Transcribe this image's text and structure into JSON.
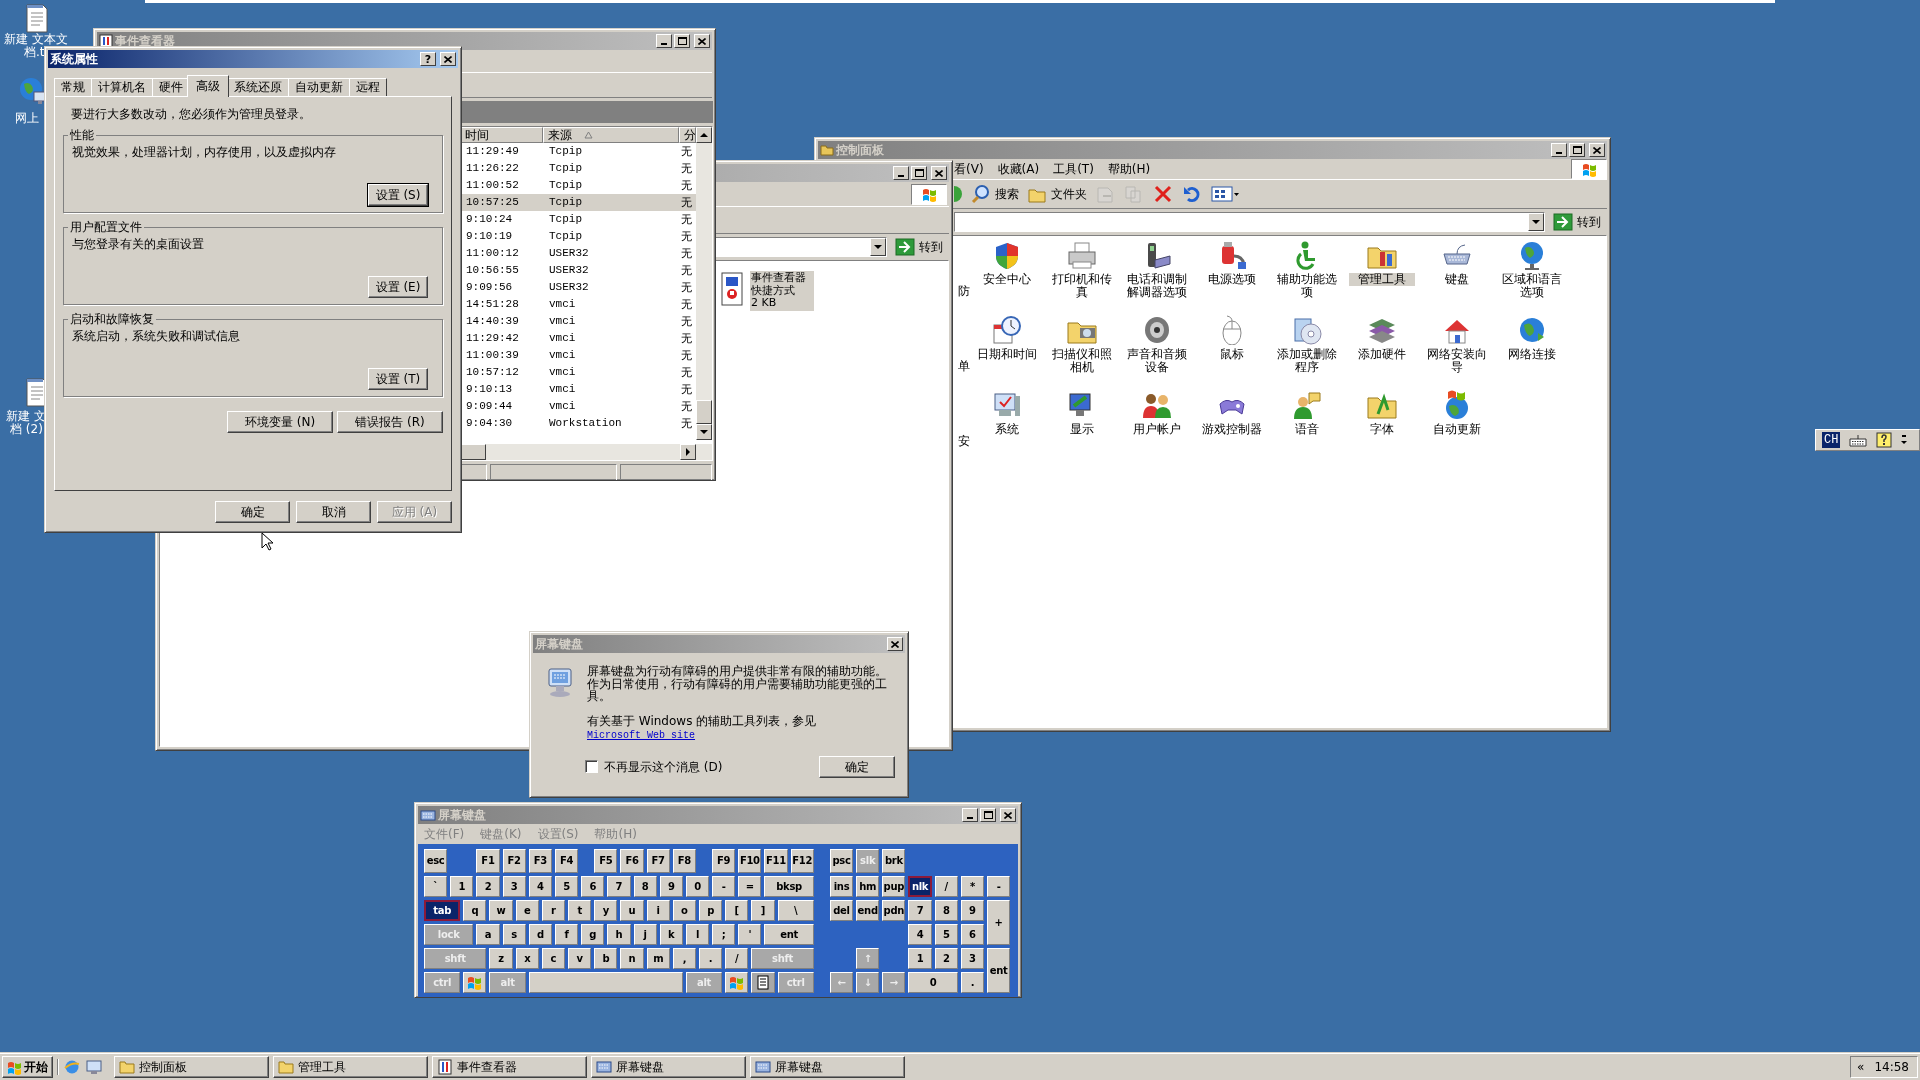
{
  "desktop_icons": [
    {
      "kind": "document",
      "lines": [
        "新建 文本文",
        "档.t"
      ]
    },
    {
      "kind": "network",
      "lines": [
        "网上"
      ]
    },
    {
      "kind": "document",
      "lines": [
        "新建 文",
        "档 (2)"
      ]
    }
  ],
  "control_panel": {
    "title": "控制面板",
    "menu": [
      "看(V)",
      "收藏(A)",
      "工具(T)",
      "帮助(H)"
    ],
    "toolbar": [
      {
        "kind": "up",
        "disabled": false
      },
      {
        "kind": "search",
        "label": "搜索",
        "disabled": false
      },
      {
        "kind": "folders",
        "label": "文件夹",
        "disabled": false
      },
      {
        "kind": "move",
        "disabled": true
      },
      {
        "kind": "copy",
        "disabled": true
      },
      {
        "kind": "delete",
        "disabled": false
      },
      {
        "kind": "undo",
        "disabled": false
      },
      {
        "kind": "views",
        "disabled": false
      }
    ],
    "go_button": "转到",
    "cut_labels": [
      "防",
      "单",
      "安"
    ],
    "items": [
      {
        "label": "安全中心",
        "selected": false
      },
      {
        "label": "打印机和传真",
        "selected": false
      },
      {
        "label": "电话和调制解调器选项",
        "selected": false
      },
      {
        "label": "电源选项",
        "selected": false
      },
      {
        "label": "辅助功能选项",
        "selected": false
      },
      {
        "label": "管理工具",
        "selected": true
      },
      {
        "label": "键盘",
        "selected": false
      },
      {
        "label": "区域和语言选项",
        "selected": false
      },
      {
        "label": "日期和时间",
        "selected": false
      },
      {
        "label": "扫描仪和照相机",
        "selected": false
      },
      {
        "label": "声音和音频设备",
        "selected": false
      },
      {
        "label": "鼠标",
        "selected": false
      },
      {
        "label": "添加或删除程序",
        "selected": false
      },
      {
        "label": "添加硬件",
        "selected": false
      },
      {
        "label": "网络安装向导",
        "selected": false
      },
      {
        "label": "网络连接",
        "selected": false
      },
      {
        "label": "系统",
        "selected": false
      },
      {
        "label": "显示",
        "selected": false
      },
      {
        "label": "用户帐户",
        "selected": false
      },
      {
        "label": "游戏控制器",
        "selected": false
      },
      {
        "label": "语音",
        "selected": false
      },
      {
        "label": "字体",
        "selected": false
      },
      {
        "label": "自动更新",
        "selected": false
      }
    ]
  },
  "explorer": {
    "go_button": "转到",
    "file": {
      "lines": [
        "事件查看器",
        "快捷方式",
        "2 KB"
      ],
      "selected": true
    }
  },
  "event_viewer": {
    "title": "事件查看器",
    "columns": [
      "时间",
      "来源",
      "分"
    ],
    "rows": [
      {
        "time": "11:29:49",
        "source": "Tcpip",
        "type": "无",
        "selected": false
      },
      {
        "time": "11:26:22",
        "source": "Tcpip",
        "type": "无",
        "selected": false
      },
      {
        "time": "11:00:52",
        "source": "Tcpip",
        "type": "无",
        "selected": false
      },
      {
        "time": "10:57:25",
        "source": "Tcpip",
        "type": "无",
        "selected": true
      },
      {
        "time": "9:10:24",
        "source": "Tcpip",
        "type": "无",
        "selected": false
      },
      {
        "time": "9:10:19",
        "source": "Tcpip",
        "type": "无",
        "selected": false
      },
      {
        "time": "11:00:12",
        "source": "USER32",
        "type": "无",
        "selected": false
      },
      {
        "time": "10:56:55",
        "source": "USER32",
        "type": "无",
        "selected": false
      },
      {
        "time": "9:09:56",
        "source": "USER32",
        "type": "无",
        "selected": false
      },
      {
        "time": "14:51:28",
        "source": "vmci",
        "type": "无",
        "selected": false
      },
      {
        "time": "14:40:39",
        "source": "vmci",
        "type": "无",
        "selected": false
      },
      {
        "time": "11:29:42",
        "source": "vmci",
        "type": "无",
        "selected": false
      },
      {
        "time": "11:00:39",
        "source": "vmci",
        "type": "无",
        "selected": false
      },
      {
        "time": "10:57:12",
        "source": "vmci",
        "type": "无",
        "selected": false
      },
      {
        "time": "9:10:13",
        "source": "vmci",
        "type": "无",
        "selected": false
      },
      {
        "time": "9:09:44",
        "source": "vmci",
        "type": "无",
        "selected": false
      },
      {
        "time": "9:04:30",
        "source": "Workstation",
        "type": "无",
        "selected": false
      }
    ]
  },
  "system_properties": {
    "title": "系统属性",
    "help_button": "?",
    "tabs": [
      {
        "label": "常规",
        "selected": false
      },
      {
        "label": "计算机名",
        "selected": false
      },
      {
        "label": "硬件",
        "selected": false
      },
      {
        "label": "高级",
        "selected": true
      },
      {
        "label": "系统还原",
        "selected": false
      },
      {
        "label": "自动更新",
        "selected": false
      },
      {
        "label": "远程",
        "selected": false
      }
    ],
    "notice": "要进行大多数改动，您必须作为管理员登录。",
    "groups": [
      {
        "title": "性能",
        "description": "视觉效果，处理器计划，内存使用，以及虚拟内存",
        "button": "设置 (S)",
        "default": true
      },
      {
        "title": "用户配置文件",
        "description": "与您登录有关的桌面设置",
        "button": "设置 (E)",
        "default": false
      },
      {
        "title": "启动和故障恢复",
        "description": "系统启动，系统失败和调试信息",
        "button": "设置 (T)",
        "default": false
      }
    ],
    "extra_buttons": [
      "环境变量 (N)",
      "错误报告 (R)"
    ],
    "footer_buttons": [
      {
        "label": "确定",
        "disabled": false
      },
      {
        "label": "取消",
        "disabled": false
      },
      {
        "label": "应用 (A)",
        "disabled": true
      }
    ]
  },
  "osk_dialog": {
    "title": "屏幕键盘",
    "message": "屏幕键盘为行动有障碍的用户提供非常有限的辅助功能。作为日常使用，行动有障碍的用户需要辅助功能更强的工具。",
    "info": "有关基于 Windows 的辅助工具列表，参见",
    "link": "Microsoft Web site",
    "checkbox": {
      "label": "不再显示这个消息 (D)",
      "checked": false
    },
    "button": "确定"
  },
  "osk": {
    "title": "屏幕键盘",
    "menu": [
      "文件(F)",
      "键盘(K)",
      "设置(S)",
      "帮助(H)"
    ],
    "keys": [
      {
        "label": "esc",
        "kind": "char",
        "on": false
      },
      {
        "label": "F1",
        "kind": "char",
        "on": false
      },
      {
        "label": "F2",
        "kind": "char",
        "on": false
      },
      {
        "label": "F3",
        "kind": "char",
        "on": false
      },
      {
        "label": "F4",
        "kind": "char",
        "on": false
      },
      {
        "label": "F5",
        "kind": "char",
        "on": false
      },
      {
        "label": "F6",
        "kind": "char",
        "on": false
      },
      {
        "label": "F7",
        "kind": "char",
        "on": false
      },
      {
        "label": "F8",
        "kind": "char",
        "on": false
      },
      {
        "label": "F9",
        "kind": "char",
        "on": false
      },
      {
        "label": "F10",
        "kind": "char",
        "on": false
      },
      {
        "label": "F11",
        "kind": "char",
        "on": false
      },
      {
        "label": "F12",
        "kind": "char",
        "on": false
      },
      {
        "label": "psc",
        "kind": "char",
        "on": false
      },
      {
        "label": "slk",
        "kind": "mod",
        "on": false
      },
      {
        "label": "brk",
        "kind": "char",
        "on": false
      },
      {
        "label": "`",
        "kind": "char",
        "on": false
      },
      {
        "label": "1",
        "kind": "char",
        "on": false
      },
      {
        "label": "2",
        "kind": "char",
        "on": false
      },
      {
        "label": "3",
        "kind": "char",
        "on": false
      },
      {
        "label": "4",
        "kind": "char",
        "on": false
      },
      {
        "label": "5",
        "kind": "char",
        "on": false
      },
      {
        "label": "6",
        "kind": "char",
        "on": false
      },
      {
        "label": "7",
        "kind": "char",
        "on": false
      },
      {
        "label": "8",
        "kind": "char",
        "on": false
      },
      {
        "label": "9",
        "kind": "char",
        "on": false
      },
      {
        "label": "0",
        "kind": "char",
        "on": false
      },
      {
        "label": "-",
        "kind": "char",
        "on": false
      },
      {
        "label": "=",
        "kind": "char",
        "on": false
      },
      {
        "label": "bksp",
        "kind": "char",
        "on": false
      },
      {
        "label": "ins",
        "kind": "char",
        "on": false
      },
      {
        "label": "hm",
        "kind": "char",
        "on": false
      },
      {
        "label": "pup",
        "kind": "char",
        "on": false
      },
      {
        "label": "nlk",
        "kind": "char",
        "on": true
      },
      {
        "label": "/",
        "kind": "char",
        "on": false
      },
      {
        "label": "*",
        "kind": "char",
        "on": false
      },
      {
        "label": "-",
        "kind": "char",
        "on": false
      },
      {
        "label": "tab",
        "kind": "char",
        "on": true
      },
      {
        "label": "q",
        "kind": "char",
        "on": false
      },
      {
        "label": "w",
        "kind": "char",
        "on": false
      },
      {
        "label": "e",
        "kind": "char",
        "on": false
      },
      {
        "label": "r",
        "kind": "char",
        "on": false
      },
      {
        "label": "t",
        "kind": "char",
        "on": false
      },
      {
        "label": "y",
        "kind": "char",
        "on": false
      },
      {
        "label": "u",
        "kind": "char",
        "on": false
      },
      {
        "label": "i",
        "kind": "char",
        "on": false
      },
      {
        "label": "o",
        "kind": "char",
        "on": false
      },
      {
        "label": "p",
        "kind": "char",
        "on": false
      },
      {
        "label": "[",
        "kind": "char",
        "on": false
      },
      {
        "label": "]",
        "kind": "char",
        "on": false
      },
      {
        "label": "\\",
        "kind": "char",
        "on": false
      },
      {
        "label": "del",
        "kind": "char",
        "on": false
      },
      {
        "label": "end",
        "kind": "char",
        "on": false
      },
      {
        "label": "pdn",
        "kind": "char",
        "on": false
      },
      {
        "label": "7",
        "kind": "char",
        "on": false
      },
      {
        "label": "8",
        "kind": "char",
        "on": false
      },
      {
        "label": "9",
        "kind": "char",
        "on": false
      },
      {
        "label": "+",
        "kind": "char",
        "on": false
      },
      {
        "label": "lock",
        "kind": "mod",
        "on": false
      },
      {
        "label": "a",
        "kind": "char",
        "on": false
      },
      {
        "label": "s",
        "kind": "char",
        "on": false
      },
      {
        "label": "d",
        "kind": "char",
        "on": false
      },
      {
        "label": "f",
        "kind": "char",
        "on": false
      },
      {
        "label": "g",
        "kind": "char",
        "on": false
      },
      {
        "label": "h",
        "kind": "char",
        "on": false
      },
      {
        "label": "j",
        "kind": "char",
        "on": false
      },
      {
        "label": "k",
        "kind": "char",
        "on": false
      },
      {
        "label": "l",
        "kind": "char",
        "on": false
      },
      {
        "label": ";",
        "kind": "char",
        "on": false
      },
      {
        "label": "'",
        "kind": "char",
        "on": false
      },
      {
        "label": "ent",
        "kind": "char",
        "on": false
      },
      {
        "label": "4",
        "kind": "char",
        "on": false
      },
      {
        "label": "5",
        "kind": "char",
        "on": false
      },
      {
        "label": "6",
        "kind": "char",
        "on": false
      },
      {
        "label": "shft",
        "kind": "mod",
        "on": false
      },
      {
        "label": "z",
        "kind": "char",
        "on": false
      },
      {
        "label": "x",
        "kind": "char",
        "on": false
      },
      {
        "label": "c",
        "kind": "char",
        "on": false
      },
      {
        "label": "v",
        "kind": "char",
        "on": false
      },
      {
        "label": "b",
        "kind": "char",
        "on": false
      },
      {
        "label": "n",
        "kind": "char",
        "on": false
      },
      {
        "label": "m",
        "kind": "char",
        "on": false
      },
      {
        "label": ",",
        "kind": "char",
        "on": false
      },
      {
        "label": ".",
        "kind": "char",
        "on": false
      },
      {
        "label": "/",
        "kind": "char",
        "on": false
      },
      {
        "label": "shft",
        "kind": "mod",
        "on": false
      },
      {
        "label": "↑",
        "kind": "mod",
        "on": false
      },
      {
        "label": "1",
        "kind": "char",
        "on": false
      },
      {
        "label": "2",
        "kind": "char",
        "on": false
      },
      {
        "label": "3",
        "kind": "char",
        "on": false
      },
      {
        "label": "ent",
        "kind": "char",
        "on": false
      },
      {
        "label": "ctrl",
        "kind": "mod",
        "on": false
      },
      {
        "kind": "win",
        "on": false
      },
      {
        "label": "alt",
        "kind": "mod",
        "on": false
      },
      {
        "kind": "space",
        "on": false
      },
      {
        "label": "alt",
        "kind": "mod",
        "on": false
      },
      {
        "kind": "win",
        "on": false
      },
      {
        "kind": "menu",
        "on": false
      },
      {
        "label": "ctrl",
        "kind": "mod",
        "on": false
      },
      {
        "label": "←",
        "kind": "mod",
        "on": false
      },
      {
        "label": "↓",
        "kind": "mod",
        "on": false
      },
      {
        "label": "→",
        "kind": "mod",
        "on": false
      },
      {
        "label": "0",
        "kind": "char",
        "on": false
      },
      {
        "label": ".",
        "kind": "char",
        "on": false
      }
    ]
  },
  "language_bar": {
    "indicator": "CH"
  },
  "taskbar": {
    "start": "开始",
    "tasks": [
      {
        "label": "控制面板",
        "kind": "folder"
      },
      {
        "label": "管理工具",
        "kind": "folder"
      },
      {
        "label": "事件查看器",
        "kind": "viewer"
      },
      {
        "label": "屏幕键盘",
        "kind": "keyboard"
      },
      {
        "label": "屏幕键盘",
        "kind": "keyboard"
      }
    ],
    "tray_expander": "«",
    "clock": "14:58"
  }
}
